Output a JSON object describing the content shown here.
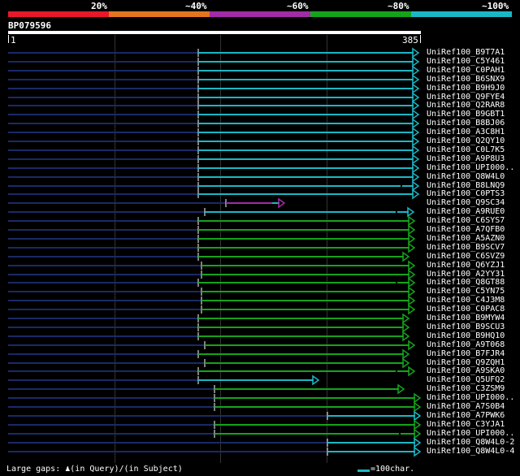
{
  "legend": {
    "labels": [
      "20%",
      "~40%",
      "~60%",
      "~80%",
      "~100%"
    ],
    "colors": [
      "#e8182b",
      "#e37520",
      "#a12ca5",
      "#15a31c",
      "#1ab8c5"
    ]
  },
  "query": {
    "id": "BP079596",
    "start": "1",
    "end": "385"
  },
  "hits": [
    {
      "id": "UniRef100_B9T7A1",
      "color": "cyan",
      "s": 244,
      "e": 515,
      "g": []
    },
    {
      "id": "UniRef100_C5Y461",
      "color": "cyan",
      "s": 244,
      "e": 515,
      "g": []
    },
    {
      "id": "UniRef100_C0PAH1",
      "color": "cyan",
      "s": 244,
      "e": 515,
      "g": []
    },
    {
      "id": "UniRef100_B6SNX9",
      "color": "cyan",
      "s": 244,
      "e": 515,
      "g": []
    },
    {
      "id": "UniRef100_B9H9J0",
      "color": "cyan",
      "s": 244,
      "e": 515,
      "g": []
    },
    {
      "id": "UniRef100_Q9FYE4",
      "color": "cyan",
      "s": 244,
      "e": 515,
      "g": []
    },
    {
      "id": "UniRef100_Q2RAR8",
      "color": "cyan",
      "s": 244,
      "e": 515,
      "g": []
    },
    {
      "id": "UniRef100_B9GBT1",
      "color": "cyan",
      "s": 244,
      "e": 515,
      "g": []
    },
    {
      "id": "UniRef100_B8BJ06",
      "color": "cyan",
      "s": 244,
      "e": 515,
      "g": []
    },
    {
      "id": "UniRef100_A3C8H1",
      "color": "cyan",
      "s": 244,
      "e": 515,
      "g": []
    },
    {
      "id": "UniRef100_Q2QY10",
      "color": "cyan",
      "s": 244,
      "e": 515,
      "g": []
    },
    {
      "id": "UniRef100_C0L7K5",
      "color": "cyan",
      "s": 244,
      "e": 515,
      "g": []
    },
    {
      "id": "UniRef100_A9P8U3",
      "color": "cyan",
      "s": 244,
      "e": 515,
      "g": []
    },
    {
      "id": "UniRef100_UPI000..",
      "color": "cyan",
      "s": 244,
      "e": 515,
      "g": []
    },
    {
      "id": "UniRef100_Q8W4L0",
      "color": "cyan",
      "s": 244,
      "e": 515,
      "g": []
    },
    {
      "id": "UniRef100_B8LNQ9",
      "color": "cyan",
      "s": 244,
      "e": 515,
      "g": [
        494
      ]
    },
    {
      "id": "UniRef100_C0PTS3",
      "color": "cyan",
      "s": 244,
      "e": 515,
      "g": []
    },
    {
      "id": "UniRef100_Q9SC34",
      "color": "purple",
      "s": 278,
      "e": 350,
      "g": [],
      "tail": 335
    },
    {
      "id": "UniRef100_A9RUE0",
      "color": "cyan",
      "s": 252,
      "e": 509,
      "g": [
        488
      ]
    },
    {
      "id": "UniRef100_C6SYS7",
      "color": "green",
      "s": 244,
      "e": 510,
      "g": []
    },
    {
      "id": "UniRef100_A7QFB0",
      "color": "green",
      "s": 244,
      "e": 510,
      "g": []
    },
    {
      "id": "UniRef100_A5AZN0",
      "color": "green",
      "s": 244,
      "e": 510,
      "g": []
    },
    {
      "id": "UniRef100_B9SCV7",
      "color": "green",
      "s": 244,
      "e": 510,
      "g": []
    },
    {
      "id": "UniRef100_C6SVZ9",
      "color": "green",
      "s": 244,
      "e": 503,
      "g": []
    },
    {
      "id": "UniRef100_Q6YZJ1",
      "color": "green",
      "s": 248,
      "e": 510,
      "g": []
    },
    {
      "id": "UniRef100_A2YY31",
      "color": "green",
      "s": 248,
      "e": 510,
      "g": []
    },
    {
      "id": "UniRef100_Q8GT88",
      "color": "green",
      "s": 244,
      "e": 510,
      "g": [
        488
      ]
    },
    {
      "id": "UniRef100_C5YN75",
      "color": "green",
      "s": 248,
      "e": 510,
      "g": []
    },
    {
      "id": "UniRef100_C4J3M8",
      "color": "green",
      "s": 248,
      "e": 510,
      "g": []
    },
    {
      "id": "UniRef100_C0PAC8",
      "color": "green",
      "s": 248,
      "e": 510,
      "g": []
    },
    {
      "id": "UniRef100_B9MYW4",
      "color": "green",
      "s": 244,
      "e": 503,
      "g": []
    },
    {
      "id": "UniRef100_B9SCU3",
      "color": "green",
      "s": 244,
      "e": 503,
      "g": []
    },
    {
      "id": "UniRef100_B9HQ10",
      "color": "green",
      "s": 244,
      "e": 503,
      "g": []
    },
    {
      "id": "UniRef100_A9T068",
      "color": "green",
      "s": 252,
      "e": 510,
      "g": []
    },
    {
      "id": "UniRef100_B7FJR4",
      "color": "green",
      "s": 244,
      "e": 503,
      "g": []
    },
    {
      "id": "UniRef100_Q9ZQH1",
      "color": "green",
      "s": 252,
      "e": 503,
      "g": []
    },
    {
      "id": "UniRef100_A9SKA0",
      "color": "green",
      "s": 244,
      "e": 510,
      "g": [
        488
      ]
    },
    {
      "id": "UniRef100_Q5UFQ2",
      "color": "cyan",
      "s": 244,
      "e": 392,
      "g": []
    },
    {
      "id": "UniRef100_C3ZSM9",
      "color": "green",
      "s": 264,
      "e": 497,
      "g": []
    },
    {
      "id": "UniRef100_UPI000..",
      "color": "green",
      "s": 264,
      "e": 517,
      "g": []
    },
    {
      "id": "UniRef100_A7S0B4",
      "color": "green",
      "s": 264,
      "e": 517,
      "g": []
    },
    {
      "id": "UniRef100_A7PWK6",
      "color": "cyan",
      "s": 403,
      "e": 517,
      "g": []
    },
    {
      "id": "UniRef100_C3YJA1",
      "color": "green",
      "s": 264,
      "e": 517,
      "g": []
    },
    {
      "id": "UniRef100_UPI000..",
      "color": "green",
      "s": 264,
      "e": 517,
      "g": [
        492
      ]
    },
    {
      "id": "UniRef100_Q8W4L0-2",
      "color": "cyan",
      "s": 403,
      "e": 517,
      "g": []
    },
    {
      "id": "UniRef100_Q8W4L0-4",
      "color": "cyan",
      "s": 403,
      "e": 517,
      "g": []
    }
  ],
  "footer": {
    "gaps_label": "Large gaps: ",
    "gaps_query": "(in Query)/",
    "gaps_subject": "(in Subject)",
    "scale_label": "=100char."
  }
}
